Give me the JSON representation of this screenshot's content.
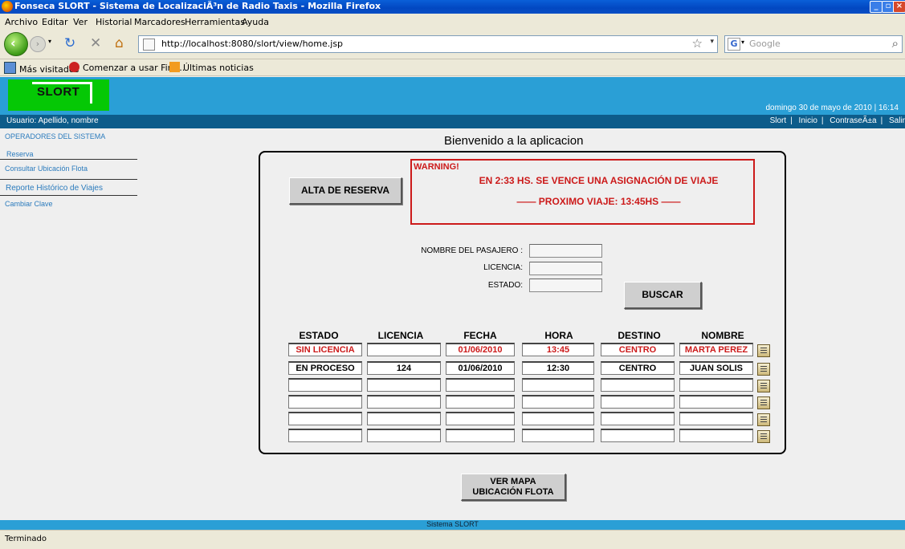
{
  "window": {
    "title": "Fonseca SLORT - Sistema de LocalizaciÃ³n de Radio Taxis - Mozilla Firefox"
  },
  "menu": [
    "Archivo",
    "Editar",
    "Ver",
    "Historial",
    "Marcadores",
    "Herramientas",
    "Ayuda"
  ],
  "nav": {
    "url": "http://localhost:8080/slort/view/home.jsp",
    "search_placeholder": "Google"
  },
  "bookmarks": [
    "Más visitados",
    "Comenzar a usar Fire...",
    "Últimas noticias"
  ],
  "header": {
    "logo": "SLORT",
    "date": "domingo 30 de mayo de 2010 | 16:14",
    "user": "Usuario: Apellido, nombre",
    "links": [
      "Slort",
      "Inicio",
      "ContraseÃ±a",
      "Salir"
    ]
  },
  "sidebar": {
    "items": [
      "OPERADORES DEL SISTEMA",
      "Reserva",
      "Consultar Ubicación Flota",
      "Reporte Histórico de Viajes",
      "Cambiar Clave"
    ]
  },
  "main": {
    "welcome": "Bienvenido a la aplicacion",
    "alta_button": "ALTA DE RESERVA",
    "warning": {
      "title": "WARNING!",
      "line1": "EN 2:33 HS. SE VENCE UNA ASIGNACIÓN DE VIAJE",
      "line2": "—— PROXIMO VIAJE: 13:45HS ——"
    },
    "search": {
      "nombre_label": "NOMBRE DEL PASAJERO :",
      "licencia_label": "LICENCIA:",
      "estado_label": "ESTADO:",
      "buscar_button": "BUSCAR"
    },
    "table": {
      "headers": [
        "ESTADO",
        "LICENCIA",
        "FECHA",
        "HORA",
        "DESTINO",
        "NOMBRE"
      ],
      "rows": [
        [
          "SIN LICENCIA",
          "",
          "01/06/2010",
          "13:45",
          "CENTRO",
          "MARTA PEREZ"
        ],
        [
          "EN PROCESO",
          "124",
          "01/06/2010",
          "12:30",
          "CENTRO",
          "JUAN SOLIS"
        ],
        [
          "",
          "",
          "",
          "",
          "",
          ""
        ],
        [
          "",
          "",
          "",
          "",
          "",
          ""
        ],
        [
          "",
          "",
          "",
          "",
          "",
          ""
        ],
        [
          "",
          "",
          "",
          "",
          "",
          ""
        ]
      ]
    },
    "map_button_l1": "VER MAPA",
    "map_button_l2": "UBICACIÓN FLOTA"
  },
  "footer": "Sistema SLORT",
  "status": "Terminado",
  "colors": {
    "header": "#2a9fd6",
    "logo": "#05c805",
    "userbar": "#0d5c8a",
    "warning": "#cc1a1a"
  }
}
